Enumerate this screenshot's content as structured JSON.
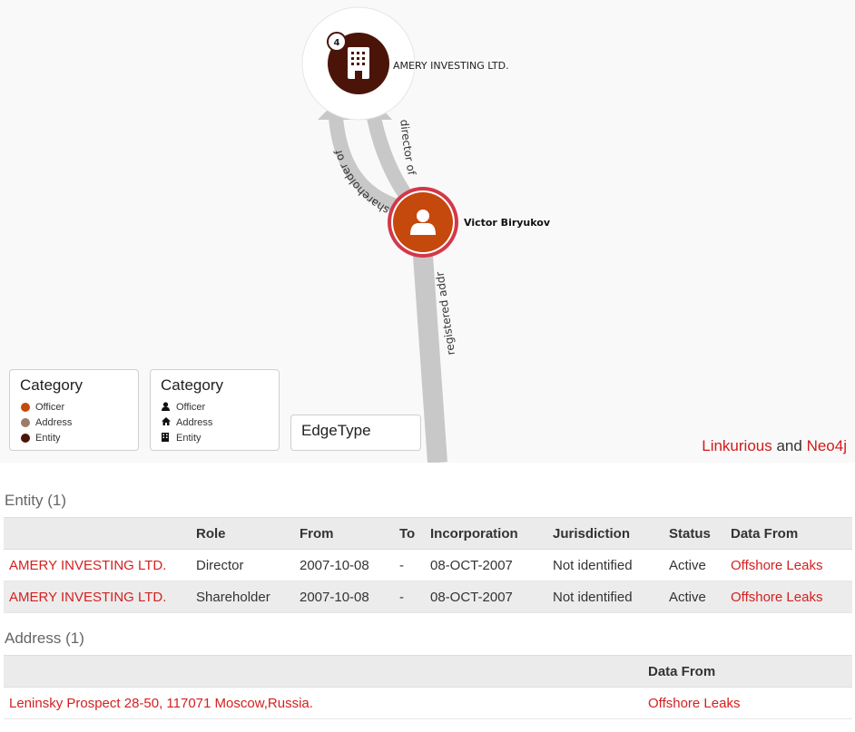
{
  "graph": {
    "entity_node": {
      "label": "AMERY INVESTING LTD.",
      "badge": "4",
      "color": "#4a1508",
      "icon": "building-icon"
    },
    "officer_node": {
      "label": "Victor Biryukov",
      "color": "#c5480c",
      "ring_color": "#d33848",
      "icon": "user-icon"
    },
    "edges": [
      {
        "label": "shareholder of"
      },
      {
        "label": "director of"
      },
      {
        "label": "registered address"
      }
    ],
    "edge_color": "#c8c8c8"
  },
  "legends": {
    "color_legend": {
      "title": "Category",
      "items": [
        {
          "label": "Officer",
          "color": "#c5480c"
        },
        {
          "label": "Address",
          "color": "#9d7b6b"
        },
        {
          "label": "Entity",
          "color": "#4a1508"
        }
      ]
    },
    "icon_legend": {
      "title": "Category",
      "items": [
        {
          "label": "Officer",
          "icon": "user-icon"
        },
        {
          "label": "Address",
          "icon": "home-icon"
        },
        {
          "label": "Entity",
          "icon": "building-icon"
        }
      ]
    },
    "edge_legend": {
      "title": "EdgeType"
    }
  },
  "credit": {
    "link1": "Linkurious",
    "and": "and",
    "link2": "Neo4j"
  },
  "entity_section": {
    "title": "Entity (1)",
    "headers": [
      "",
      "Role",
      "From",
      "To",
      "Incorporation",
      "Jurisdiction",
      "Status",
      "Data From"
    ],
    "rows": [
      [
        "AMERY INVESTING LTD.",
        "Director",
        "2007-10-08",
        "-",
        "08-OCT-2007",
        "Not identified",
        "Active",
        "Offshore Leaks"
      ],
      [
        "AMERY INVESTING LTD.",
        "Shareholder",
        "2007-10-08",
        "-",
        "08-OCT-2007",
        "Not identified",
        "Active",
        "Offshore Leaks"
      ]
    ]
  },
  "address_section": {
    "title": "Address (1)",
    "headers": [
      "",
      "Data From"
    ],
    "rows": [
      [
        "Leninsky Prospect 28-50, 117071 Moscow,Russia.",
        "Offshore Leaks"
      ]
    ]
  }
}
